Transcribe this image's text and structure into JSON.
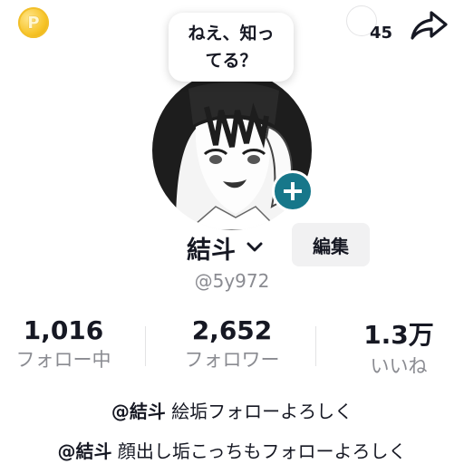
{
  "top_bar": {
    "coin_icon": "coin-icon",
    "coin_symbol": "P",
    "views_count": "45",
    "share_icon": "share-arrow-icon"
  },
  "avatar": {
    "bubble_line1": "ねえ、知っ",
    "bubble_line2": "てる？",
    "add_icon": "plus-icon"
  },
  "profile": {
    "name": "結斗",
    "name_dropdown_icon": "chevron-down-icon",
    "edit_label": "編集",
    "handle": "@5y972"
  },
  "stats": [
    {
      "value": "1,016",
      "label": "フォロー中"
    },
    {
      "value": "2,652",
      "label": "フォロワー"
    },
    {
      "value": "1.3万",
      "label": "いいね"
    }
  ],
  "bio": {
    "line1_mention": "@結斗",
    "line1_text": " 絵垢フォローよろしく",
    "line2_mention": "@結斗",
    "line2_text": " 顔出し垢こっちもフォローよろしく"
  },
  "colors": {
    "accent_teal": "#17778a",
    "coin_gold": "#f7c52b",
    "muted_text": "#8a8b91",
    "primary_text": "#161823"
  }
}
